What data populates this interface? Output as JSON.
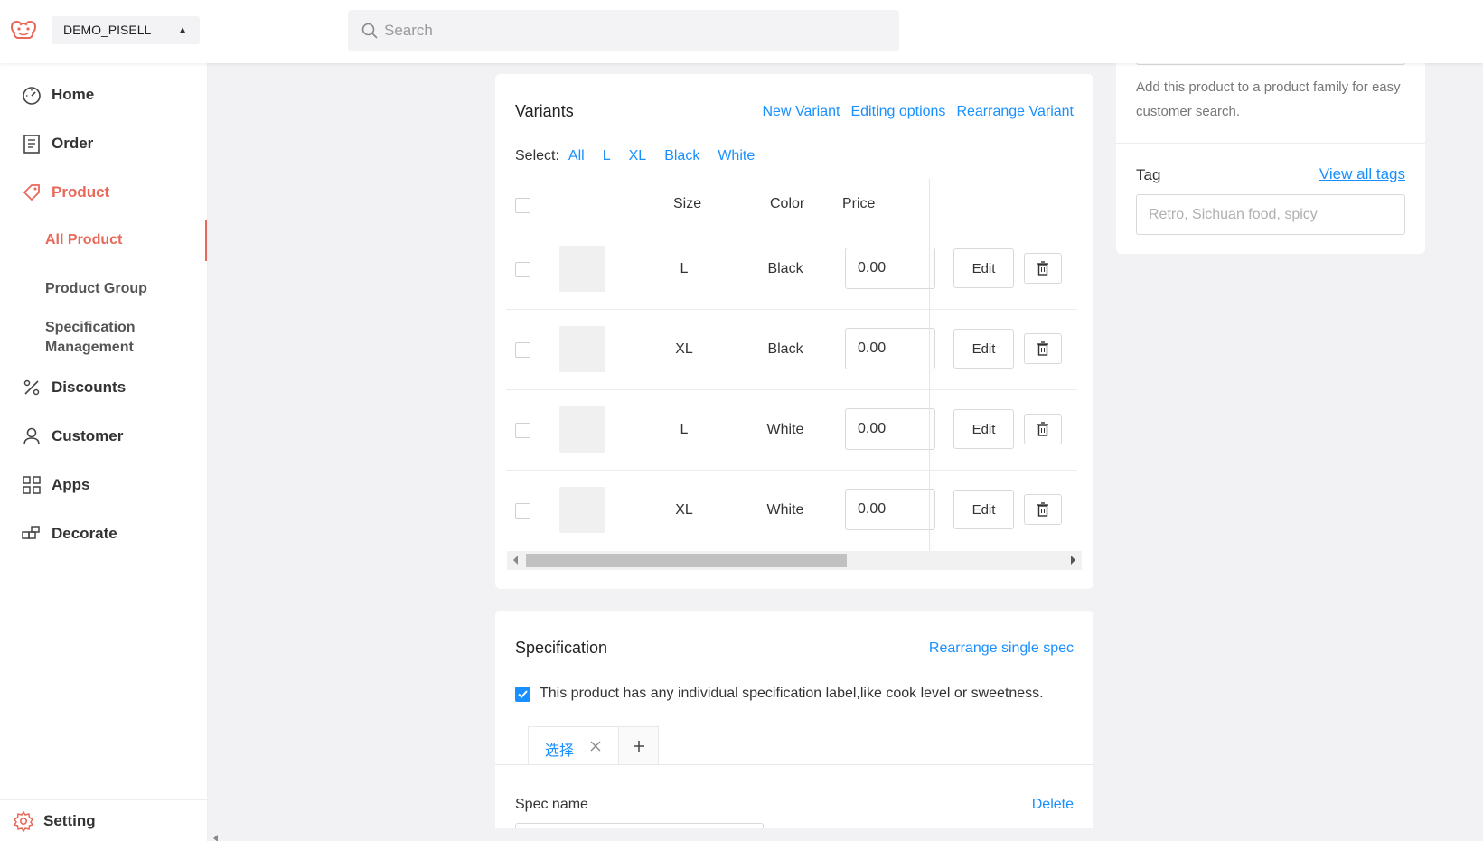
{
  "header": {
    "store_name": "DEMO_PISELL",
    "search_placeholder": "Search"
  },
  "sidebar": {
    "items": [
      {
        "label": "Home"
      },
      {
        "label": "Order"
      },
      {
        "label": "Product"
      },
      {
        "label": "Discounts"
      },
      {
        "label": "Customer"
      },
      {
        "label": "Apps"
      },
      {
        "label": "Decorate"
      }
    ],
    "product_sub": [
      {
        "label": "All Product"
      },
      {
        "label": "Product Group"
      },
      {
        "label": "Specification Management"
      }
    ],
    "setting_label": "Setting"
  },
  "variants": {
    "title": "Variants",
    "actions": {
      "new_variant": "New Variant",
      "editing_options": "Editing options",
      "rearrange_variant": "Rearrange Variant"
    },
    "select_label": "Select:",
    "filters": [
      "All",
      "L",
      "XL",
      "Black",
      "White"
    ],
    "columns": {
      "size": "Size",
      "color": "Color",
      "price": "Price"
    },
    "edit_label": "Edit",
    "rows": [
      {
        "size": "L",
        "color": "Black",
        "price": "0.00"
      },
      {
        "size": "XL",
        "color": "Black",
        "price": "0.00"
      },
      {
        "size": "L",
        "color": "White",
        "price": "0.00"
      },
      {
        "size": "XL",
        "color": "White",
        "price": "0.00"
      }
    ]
  },
  "specification": {
    "title": "Specification",
    "rearrange": "Rearrange single spec",
    "checkbox_label": "This product has any individual specification label,like cook level or sweetness.",
    "tab_label": "选择",
    "spec_name_label": "Spec name",
    "delete_label": "Delete"
  },
  "right_panel": {
    "family_hint": "Add this product to a product family for easy customer search.",
    "tag_label": "Tag",
    "view_all_tags": "View all tags",
    "tag_placeholder": "Retro, Sichuan food, spicy"
  }
}
